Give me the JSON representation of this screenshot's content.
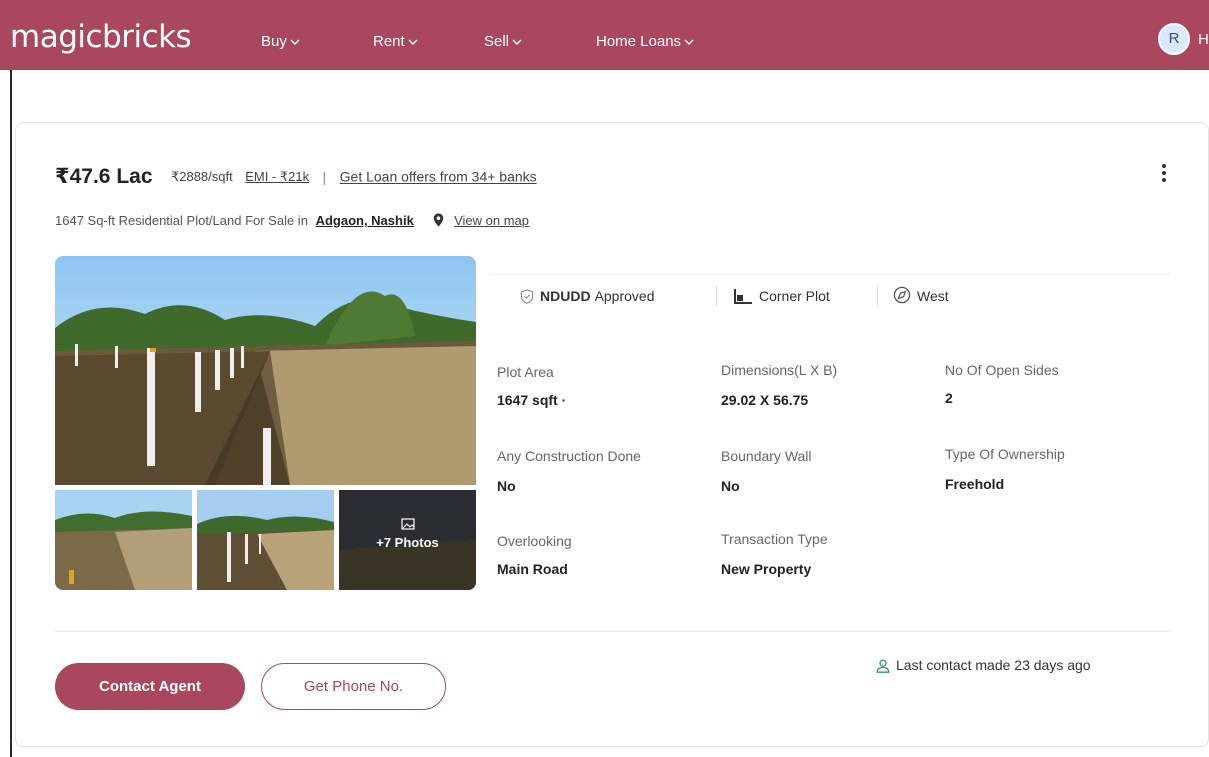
{
  "header": {
    "logo": "magicbricks",
    "nav": [
      "Buy",
      "Rent",
      "Sell",
      "Home Loans"
    ],
    "avatar_initial": "R",
    "avatar_tail": "H"
  },
  "listing": {
    "price": "₹47.6 Lac",
    "price_per_sqft": "₹2888/sqft",
    "emi": "EMI - ₹21k",
    "separator": "|",
    "loan_offers": "Get Loan offers from 34+ banks",
    "subtitle": "1647 Sq-ft Residential Plot/Land For Sale in",
    "locality": "Adgaon, Nashik",
    "map_link": "View on map",
    "badges": [
      {
        "bold": "NDUDD",
        "text": "Approved"
      },
      {
        "text": "Corner Plot"
      },
      {
        "text": "West"
      }
    ],
    "details": [
      {
        "label": "Plot Area",
        "value": "1647 sqft ·"
      },
      {
        "label": "Dimensions(L X B)",
        "value": "29.02 X 56.75"
      },
      {
        "label": "No Of Open Sides",
        "value": "2"
      },
      {
        "label": "Any Construction Done",
        "value": "No"
      },
      {
        "label": "Boundary Wall",
        "value": "No"
      },
      {
        "label": "Type Of Ownership",
        "value": "Freehold"
      },
      {
        "label": "Overlooking",
        "value": "Main Road"
      },
      {
        "label": "Transaction Type",
        "value": "New Property"
      }
    ],
    "more_photos": "+7 Photos"
  },
  "footer": {
    "contact_agent": "Contact Agent",
    "get_phone": "Get Phone No.",
    "last_contact": "Last contact made 23 days ago"
  },
  "colors": {
    "brand": "#a8475d",
    "badge_icon": "#888888",
    "last_contact_icon": "#2e9e5b"
  }
}
